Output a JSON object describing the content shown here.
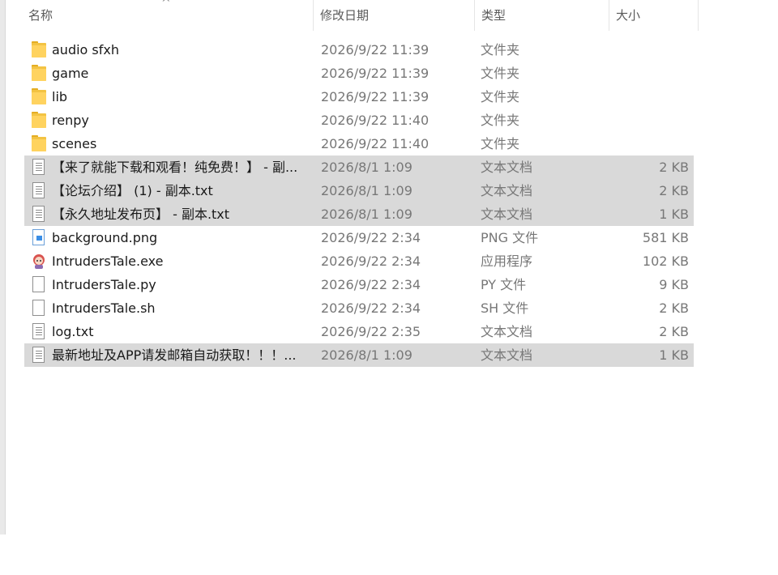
{
  "columns": {
    "name": "名称",
    "date": "修改日期",
    "type": "类型",
    "size": "大小"
  },
  "sort_indicator": "^",
  "files": [
    {
      "name": "audio sfxh",
      "date": "2026/9/22 11:39",
      "type": "文件夹",
      "size": "",
      "icon": "folder-icon",
      "selected": false
    },
    {
      "name": "game",
      "date": "2026/9/22 11:39",
      "type": "文件夹",
      "size": "",
      "icon": "folder-icon",
      "selected": false
    },
    {
      "name": "lib",
      "date": "2026/9/22 11:39",
      "type": "文件夹",
      "size": "",
      "icon": "folder-icon",
      "selected": false
    },
    {
      "name": "renpy",
      "date": "2026/9/22 11:40",
      "type": "文件夹",
      "size": "",
      "icon": "folder-icon",
      "selected": false
    },
    {
      "name": "scenes",
      "date": "2026/9/22 11:40",
      "type": "文件夹",
      "size": "",
      "icon": "folder-icon",
      "selected": false
    },
    {
      "name": "【来了就能下载和观看！纯免费！】 - 副...",
      "date": "2026/8/1 1:09",
      "type": "文本文档",
      "size": "2 KB",
      "icon": "text-file-icon",
      "selected": true
    },
    {
      "name": "【论坛介绍】 (1) - 副本.txt",
      "date": "2026/8/1 1:09",
      "type": "文本文档",
      "size": "2 KB",
      "icon": "text-file-icon",
      "selected": true
    },
    {
      "name": "【永久地址发布页】 - 副本.txt",
      "date": "2026/8/1 1:09",
      "type": "文本文档",
      "size": "1 KB",
      "icon": "text-file-icon",
      "selected": true
    },
    {
      "name": "background.png",
      "date": "2026/9/22 2:34",
      "type": "PNG 文件",
      "size": "581 KB",
      "icon": "image-file-icon",
      "selected": false
    },
    {
      "name": "IntrudersTale.exe",
      "date": "2026/9/22 2:34",
      "type": "应用程序",
      "size": "102 KB",
      "icon": "app-icon",
      "selected": false
    },
    {
      "name": "IntrudersTale.py",
      "date": "2026/9/22 2:34",
      "type": "PY 文件",
      "size": "9 KB",
      "icon": "blank-file-icon",
      "selected": false
    },
    {
      "name": "IntrudersTale.sh",
      "date": "2026/9/22 2:34",
      "type": "SH 文件",
      "size": "2 KB",
      "icon": "blank-file-icon",
      "selected": false
    },
    {
      "name": "log.txt",
      "date": "2026/9/22 2:35",
      "type": "文本文档",
      "size": "2 KB",
      "icon": "text-file-icon",
      "selected": false
    },
    {
      "name": "最新地址及APP请发邮箱自动获取！！！...",
      "date": "2026/8/1 1:09",
      "type": "文本文档",
      "size": "1 KB",
      "icon": "text-file-icon",
      "selected": true
    }
  ]
}
